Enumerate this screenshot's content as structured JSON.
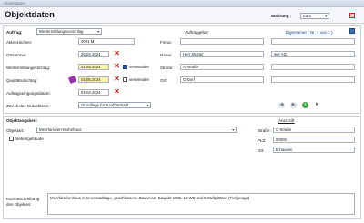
{
  "window": {
    "title": "Objektdaten"
  },
  "header": {
    "page_title": "Objektdaten",
    "currency_label": "Währung :",
    "currency_value": "Euro"
  },
  "auftrag": {
    "label": "Auftrag:",
    "type_value": "Wertermittlungsvorschlag",
    "fields": {
      "aktenzeichen": {
        "label": "Aktenzeichen:",
        "value": "0001 M"
      },
      "ortstermin": {
        "label": "Ortstermin:",
        "value": "20.04.2024"
      },
      "wertermittlungsstichtag": {
        "label": "Wertermittlungsstichtag:",
        "value": "01.05.2024",
        "check_label": "verwenden"
      },
      "qualitaetsstichtag": {
        "label": "Qualitätsstichtag:",
        "value": "01.05.2024",
        "check_label": "verwenden"
      },
      "auftragseingangsdatum": {
        "label": "Auftragseingangsdatum:",
        "value": "01.04.2024"
      }
    },
    "zweck_label": "Zweck des Gutachtens:",
    "zweck_value": "Grundlage für Kauf/Verkauf"
  },
  "auftraggeber": {
    "heading": "Auftraggeber",
    "firma_label": "Firma:",
    "firma_value": "",
    "name_label": "Name:",
    "name_value": "Herr Muster",
    "strasse_label": "Straße:",
    "strasse_value": "A-Straße",
    "ort_label": "Ort:",
    "ort_value": "G-Dorf"
  },
  "eigentuemer": {
    "heading": "Eigentümer ( Nr. 1 von 1 )",
    "firma_value": "",
    "name_value": "wer AG",
    "strasse_value": "",
    "ort_value": ""
  },
  "objekt": {
    "heading": "Objektangaben:",
    "objektart_label": "Objektart:",
    "objektart_value": "Mehrfamilien-Wohnhaus",
    "nebengebaeude_label": "Nebengebäude",
    "anschrift_heading": "Anschrift",
    "strasse_label": "Straße:",
    "strasse_value": "C-Straße",
    "plz_label": "PLZ:",
    "plz_value": "00000",
    "ort_label": "Ort:",
    "ort_value": "B-hausen",
    "kurz_label_1": "Kurzbeschreibung",
    "kurz_label_2": "des Objektes:",
    "kurz_value": "Mehrfamilienhaus in Innenstadtlage, geschlossene Bauweise, Baujahr 1985, 10 WE und 8 Stellplätzen (Tiefgarage)"
  },
  "icons": {
    "close": "close-icon",
    "delete": "x-icon",
    "calendar": "calendar-icon",
    "nav_prev": "arrow-left-icon",
    "nav_next": "arrow-right-icon",
    "add": "plus-icon",
    "remove": "remove-icon"
  },
  "colors": {
    "highlight": "#fbf3a6",
    "delete": "#d32020",
    "accent": "#2f5fb3"
  }
}
